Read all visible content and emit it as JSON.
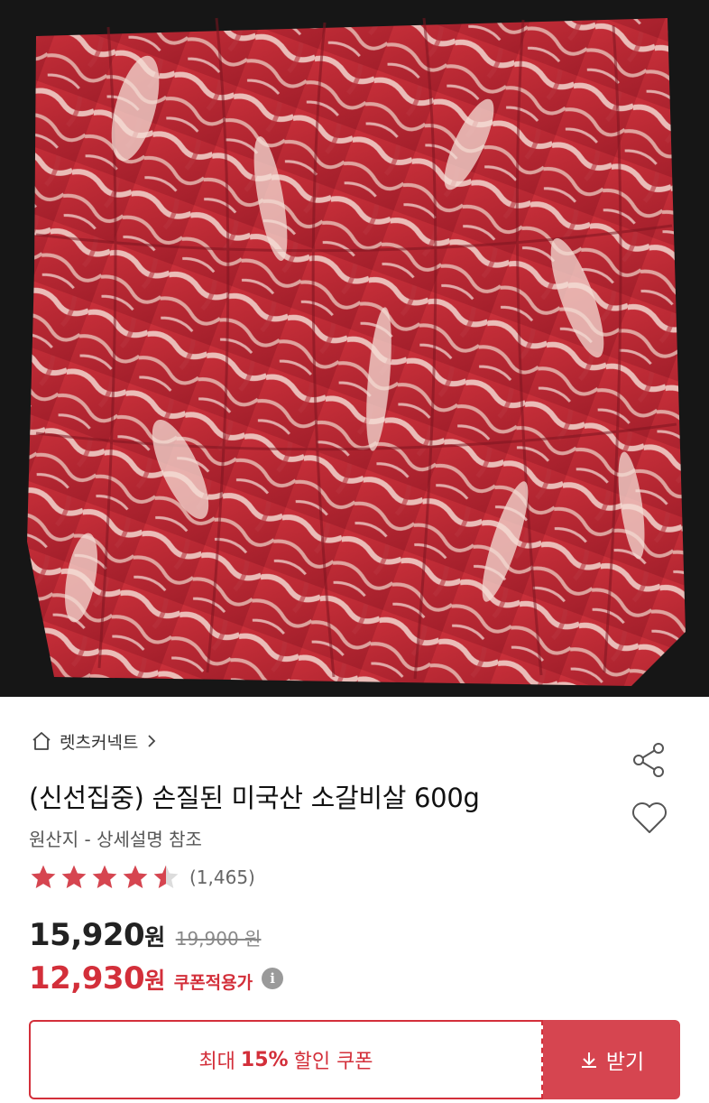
{
  "store": {
    "name": "렛츠커넥트"
  },
  "product": {
    "title": "(신선집중) 손질된 미국산 소갈비살 600g",
    "origin": "원산지 - 상세설명 참조",
    "rating": 4.5,
    "review_count": "(1,465)"
  },
  "price": {
    "sale": "15,920",
    "sale_unit": "원",
    "original": "19,900 원",
    "coupon": "12,930",
    "coupon_unit": "원",
    "coupon_label": "쿠폰적용가",
    "info_glyph": "i"
  },
  "coupon": {
    "prefix": "최대",
    "percent": "15%",
    "suffix": "할인 쿠폰",
    "button_label": "받기"
  },
  "icons": {
    "home": "home-icon",
    "chevron": "chevron-right-icon",
    "share": "share-icon",
    "wish": "heart-icon",
    "star": "star-icon",
    "download": "download-icon",
    "info": "info-icon"
  },
  "colors": {
    "accent": "#d32f3a",
    "button_bg": "#d64550",
    "star": "#d64550",
    "image_bg": "#1a1a1a"
  }
}
